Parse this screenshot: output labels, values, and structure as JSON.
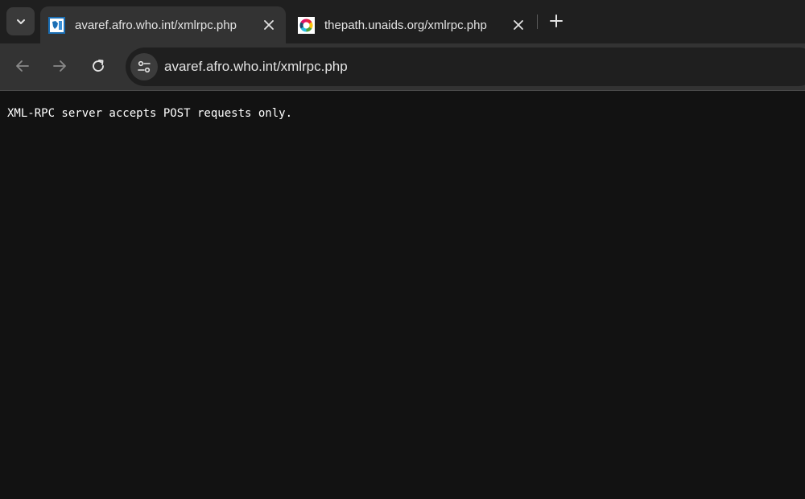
{
  "tabs": [
    {
      "title": "avaref.afro.who.int/xmlrpc.php",
      "favicon": "who-afro-favicon",
      "active": true
    },
    {
      "title": "thepath.unaids.org/xmlrpc.php",
      "favicon": "sdg-wheel-favicon",
      "active": false
    }
  ],
  "toolbar": {
    "url": "avaref.afro.who.int/xmlrpc.php"
  },
  "page": {
    "body_text": "XML-RPC server accepts POST requests only."
  },
  "icons": {
    "tab_search": "chevron-down-icon",
    "close": "close-icon",
    "new_tab": "plus-icon",
    "back": "back-arrow-icon",
    "forward": "forward-arrow-icon",
    "reload": "reload-icon",
    "site_info": "tune-icon"
  },
  "colors": {
    "tabbar_bg": "#1f1f1f",
    "active_tab_bg": "#333333",
    "omnibox_bg": "#1f1f1f",
    "page_bg": "#121212",
    "text": "#e3e3e3"
  }
}
